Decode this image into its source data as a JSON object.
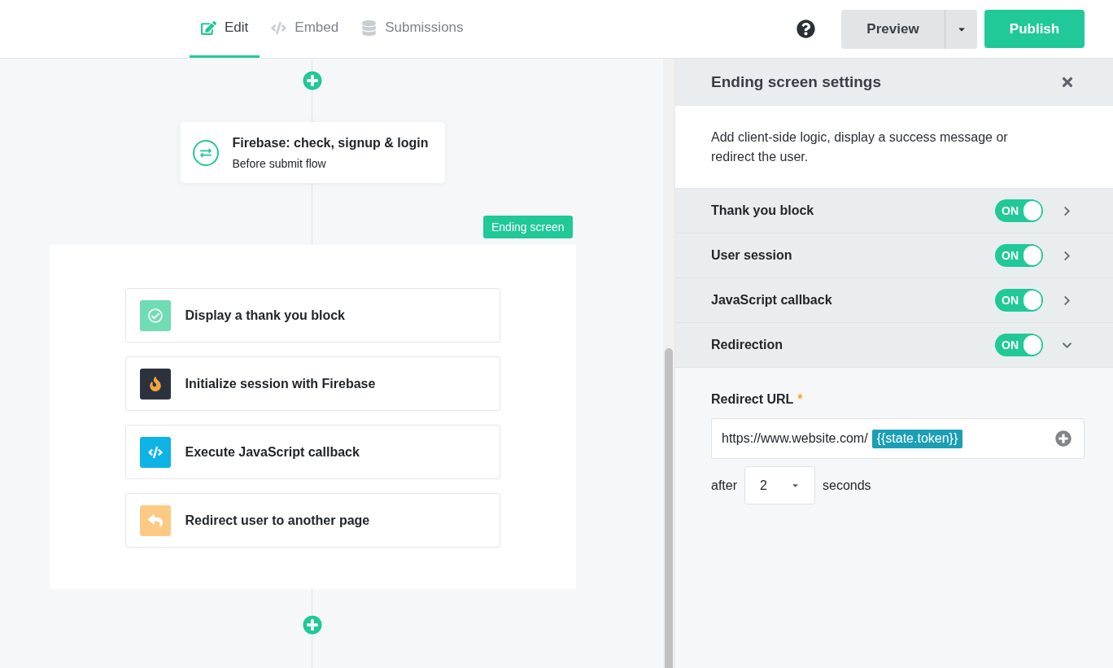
{
  "tabs": [
    {
      "label": "Edit",
      "kind": "edit",
      "selected": true
    },
    {
      "label": "Embed",
      "kind": "embed",
      "selected": false
    },
    {
      "label": "Submissions",
      "kind": "submissions",
      "selected": false
    }
  ],
  "header_buttons": {
    "preview": "Preview",
    "publish": "Publish"
  },
  "flow_step": {
    "title": "Firebase: check, signup & login",
    "subtitle": "Before submit flow"
  },
  "ending_screen": {
    "badge": "Ending screen",
    "actions": [
      {
        "label": "Display a thank you block",
        "kind": "thank_you"
      },
      {
        "label": "Initialize session with Firebase",
        "kind": "firebase"
      },
      {
        "label": "Execute JavaScript callback",
        "kind": "javascript"
      },
      {
        "label": "Redirect user to another page",
        "kind": "redirect"
      }
    ]
  },
  "settings_panel": {
    "title": "Ending screen settings",
    "description": "Add client-side logic, display a success message or redirect the user.",
    "sections": [
      {
        "label": "Thank you block",
        "toggle": "ON",
        "on": true,
        "expanded": false
      },
      {
        "label": "User session",
        "toggle": "ON",
        "on": true,
        "expanded": false
      },
      {
        "label": "JavaScript callback",
        "toggle": "ON",
        "on": true,
        "expanded": false
      },
      {
        "label": "Redirection",
        "toggle": "ON",
        "on": true,
        "expanded": true
      }
    ],
    "redirect_url": {
      "label": "Redirect URL",
      "required_mark": "*",
      "value": "https://www.website.com/",
      "token": "{{state.token}}"
    },
    "delay": {
      "before": "after",
      "value": "2",
      "after": "seconds"
    }
  }
}
